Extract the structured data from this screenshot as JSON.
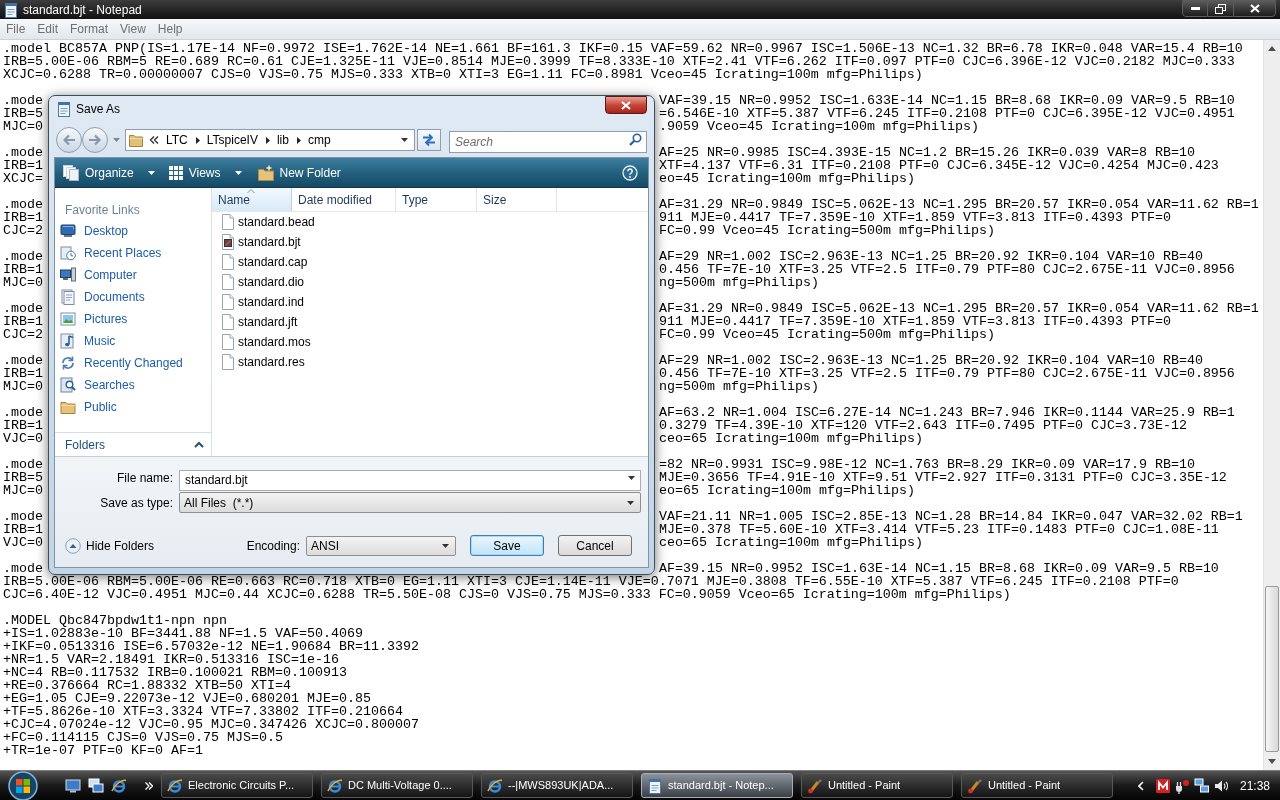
{
  "window": {
    "title": "standard.bjt - Notepad"
  },
  "menu": [
    "File",
    "Edit",
    "Format",
    "View",
    "Help"
  ],
  "editor": {
    "lines": [
      {
        "kind": "text",
        "text": ".model BC857A PNP(IS=1.17E-14 NF=0.9972 ISE=1.762E-14 NE=1.661 BF=161.3 IKF=0.15 VAF=59.62 NR=0.9967 ISC=1.506E-13 NC=1.32 BR=6.78 IKR=0.048 VAR=15.4 RB=10"
      },
      {
        "kind": "text",
        "text": "IRB=5.00E-06 RBM=5 RE=0.689 RC=0.61 CJE=1.325E-11 VJE=0.8514 MJE=0.3999 TF=8.333E-10 XTF=2.41 VTF=6.262 ITF=0.097 PTF=0 CJC=6.396E-12 VJC=0.2182 MJC=0.333"
      },
      {
        "kind": "text",
        "text": "XCJC=0.6288 TR=0.00000007 CJS=0 VJS=0.75 MJS=0.333 XTB=0 XTI=3 EG=1.11 FC=0.8981 Vceo=45 Icrating=100m mfg=Philips)"
      },
      {
        "kind": "blank"
      },
      {
        "kind": "split",
        "left": ".mode",
        "right": "VAF=39.15 NR=0.9952 ISC=1.633E-14 NC=1.15 BR=8.68 IKR=0.09 VAR=9.5 RB=10"
      },
      {
        "kind": "split",
        "left": "IRB=5",
        "right": "=6.546E-10 XTF=5.387 VTF=6.245 ITF=0.2108 PTF=0 CJC=6.395E-12 VJC=0.4951"
      },
      {
        "kind": "split",
        "left": "MJC=0",
        "right": ".9059 Vceo=45 Icrating=100m mfg=Philips)"
      },
      {
        "kind": "blank"
      },
      {
        "kind": "split",
        "left": ".mode",
        "right": "AF=25 NR=0.9985 ISC=4.393E-15 NC=1.2 BR=15.26 IKR=0.039 VAR=8 RB=10"
      },
      {
        "kind": "split",
        "left": "IRB=1",
        "right": "XTF=4.137 VTF=6.31 ITF=0.2108 PTF=0 CJC=6.345E-12 VJC=0.4254 MJC=0.423"
      },
      {
        "kind": "split",
        "left": "XCJC=",
        "right": "eo=45 Icrating=100m mfg=Philips)"
      },
      {
        "kind": "blank"
      },
      {
        "kind": "split",
        "left": ".mode",
        "right": "AF=31.29 NR=0.9849 ISC=5.062E-13 NC=1.295 BR=20.57 IKR=0.054 VAR=11.62 RB=1"
      },
      {
        "kind": "split",
        "left": "IRB=1",
        "right": "911 MJE=0.4417 TF=7.359E-10 XTF=1.859 VTF=3.813 ITF=0.4393 PTF=0"
      },
      {
        "kind": "split",
        "left": "CJC=2",
        "right": "FC=0.99 Vceo=45 Icrating=500m mfg=Philips)"
      },
      {
        "kind": "blank"
      },
      {
        "kind": "split",
        "left": ".mode",
        "right": "AF=29 NR=1.002 ISC=2.963E-13 NC=1.25 BR=20.92 IKR=0.104 VAR=10 RB=40"
      },
      {
        "kind": "split",
        "left": "IRB=1",
        "right": "0.456 TF=7E-10 XTF=3.25 VTF=2.5 ITF=0.79 PTF=80 CJC=2.675E-11 VJC=0.8956"
      },
      {
        "kind": "split",
        "left": "MJC=0",
        "right": "ng=500m mfg=Philips)"
      },
      {
        "kind": "blank"
      },
      {
        "kind": "split",
        "left": ".mode",
        "right": "AF=31.29 NR=0.9849 ISC=5.062E-13 NC=1.295 BR=20.57 IKR=0.054 VAR=11.62 RB=1"
      },
      {
        "kind": "split",
        "left": "IRB=1",
        "right": "911 MJE=0.4417 TF=7.359E-10 XTF=1.859 VTF=3.813 ITF=0.4393 PTF=0"
      },
      {
        "kind": "split",
        "left": "CJC=2",
        "right": "FC=0.99 Vceo=45 Icrating=500m mfg=Philips)"
      },
      {
        "kind": "blank"
      },
      {
        "kind": "split",
        "left": ".mode",
        "right": "AF=29 NR=1.002 ISC=2.963E-13 NC=1.25 BR=20.92 IKR=0.104 VAR=10 RB=40"
      },
      {
        "kind": "split",
        "left": "IRB=1",
        "right": "0.456 TF=7E-10 XTF=3.25 VTF=2.5 ITF=0.79 PTF=80 CJC=2.675E-11 VJC=0.8956"
      },
      {
        "kind": "split",
        "left": "MJC=0",
        "right": "ng=500m mfg=Philips)"
      },
      {
        "kind": "blank"
      },
      {
        "kind": "split",
        "left": ".mode",
        "right": "AF=63.2 NR=1.004 ISC=6.27E-14 NC=1.243 BR=7.946 IKR=0.1144 VAR=25.9 RB=1"
      },
      {
        "kind": "split",
        "left": "IRB=1",
        "right": "0.3279 TF=4.39E-10 XTF=120 VTF=2.643 ITF=0.7495 PTF=0 CJC=3.73E-12"
      },
      {
        "kind": "split",
        "left": "VJC=0",
        "right": "ceo=65 Icrating=100m mfg=Philips)"
      },
      {
        "kind": "blank"
      },
      {
        "kind": "split",
        "left": ".mode",
        "right": "=82 NR=0.9931 ISC=9.98E-12 NC=1.763 BR=8.29 IKR=0.09 VAR=17.9 RB=10"
      },
      {
        "kind": "split",
        "left": "IRB=5",
        "right": "MJE=0.3656 TF=4.91E-10 XTF=9.51 VTF=2.927 ITF=0.3131 PTF=0 CJC=3.35E-12"
      },
      {
        "kind": "split",
        "left": "MJC=0",
        "right": "eo=65 Icrating=100m mfg=Philips)"
      },
      {
        "kind": "blank"
      },
      {
        "kind": "split",
        "left": ".mode",
        "right": "VAF=21.11 NR=1.005 ISC=2.85E-13 NC=1.28 BR=14.84 IKR=0.047 VAR=32.02 RB=1"
      },
      {
        "kind": "split",
        "left": "IRB=1",
        "right": "MJE=0.378 TF=5.60E-10 XTF=3.414 VTF=5.23 ITF=0.1483 PTF=0 CJC=1.08E-11"
      },
      {
        "kind": "split",
        "left": "VJC=0",
        "right": "ceo=65 Icrating=100m mfg=Philips)"
      },
      {
        "kind": "blank"
      },
      {
        "kind": "split",
        "left": ".mode",
        "right": "AF=39.15 NR=0.9952 ISC=1.63E-14 NC=1.15 BR=8.68 IKR=0.09 VAR=9.5 RB=10"
      },
      {
        "kind": "text",
        "text": "IRB=5.00E-06 RBM=5.00E-06 RE=0.663 RC=0.718 XTB=0 EG=1.11 XTI=3 CJE=1.14E-11 VJE=0.7071 MJE=0.3808 TF=6.55E-10 XTF=5.387 VTF=6.245 ITF=0.2108 PTF=0"
      },
      {
        "kind": "text",
        "text": "CJC=6.40E-12 VJC=0.4951 MJC=0.44 XCJC=0.6288 TR=5.50E-08 CJS=0 VJS=0.75 MJS=0.333 FC=0.9059 Vceo=65 Icrating=100m mfg=Philips)"
      },
      {
        "kind": "blank"
      },
      {
        "kind": "text",
        "text": ".MODEL Qbc847bpdw1t1-npn npn"
      },
      {
        "kind": "text",
        "text": "+IS=1.02883e-10 BF=3441.88 NF=1.5 VAF=50.4069"
      },
      {
        "kind": "text",
        "text": "+IKF=0.0513316 ISE=6.57032e-12 NE=1.90684 BR=11.3392"
      },
      {
        "kind": "text",
        "text": "+NR=1.5 VAR=2.18491 IKR=0.513316 ISC=1e-16"
      },
      {
        "kind": "text",
        "text": "+NC=4 RB=0.117532 IRB=0.100021 RBM=0.100913"
      },
      {
        "kind": "text",
        "text": "+RE=0.376664 RC=1.88332 XTB=50 XTI=4"
      },
      {
        "kind": "text",
        "text": "+EG=1.05 CJE=9.22073e-12 VJE=0.680201 MJE=0.85"
      },
      {
        "kind": "text",
        "text": "+TF=5.8626e-10 XTF=3.3324 VTF=7.33802 ITF=0.210664"
      },
      {
        "kind": "text",
        "text": "+CJC=4.07024e-12 VJC=0.95 MJC=0.347426 XCJC=0.800007"
      },
      {
        "kind": "text",
        "text": "+FC=0.114115 CJS=0 VJS=0.75 MJS=0.5"
      },
      {
        "kind": "text",
        "text": "+TR=1e-07 PTF=0 KF=0 AF=1"
      }
    ]
  },
  "dialog": {
    "title": "Save As",
    "breadcrumb": [
      "LTC",
      "LTspiceIV",
      "lib",
      "cmp"
    ],
    "search": {
      "placeholder": "Search"
    },
    "toolbar": [
      {
        "label": "Organize",
        "dropdown": true
      },
      {
        "label": "Views",
        "dropdown": true
      },
      {
        "label": "New Folder",
        "dropdown": false
      }
    ],
    "favorite_links": {
      "title": "Favorite Links",
      "items": [
        "Desktop",
        "Recent Places",
        "Computer",
        "Documents",
        "Pictures",
        "Music",
        "Recently Changed",
        "Searches",
        "Public"
      ]
    },
    "folders": {
      "label": "Folders",
      "expanded": false
    },
    "columns": [
      {
        "label": "Name",
        "sorted": true
      },
      {
        "label": "Date modified",
        "sorted": false
      },
      {
        "label": "Type",
        "sorted": false
      },
      {
        "label": "Size",
        "sorted": false
      }
    ],
    "files": [
      {
        "name": "standard.bead",
        "kind": "plain"
      },
      {
        "name": "standard.bjt",
        "kind": "app"
      },
      {
        "name": "standard.cap",
        "kind": "plain"
      },
      {
        "name": "standard.dio",
        "kind": "plain"
      },
      {
        "name": "standard.ind",
        "kind": "plain"
      },
      {
        "name": "standard.jft",
        "kind": "plain"
      },
      {
        "name": "standard.mos",
        "kind": "plain"
      },
      {
        "name": "standard.res",
        "kind": "plain"
      }
    ],
    "file_name": {
      "label": "File name:",
      "value": "standard.bjt"
    },
    "save_as_type": {
      "label": "Save as type:",
      "value": "All Files  (*.*)"
    },
    "hide_folders": "Hide Folders",
    "encoding": {
      "label": "Encoding:",
      "value": "ANSI"
    },
    "buttons": [
      {
        "label": "Save",
        "default": true
      },
      {
        "label": "Cancel",
        "default": false
      }
    ]
  },
  "taskbar": {
    "tasks": [
      {
        "label": "Electronic Circuits P...",
        "kind": "browser",
        "selected": false
      },
      {
        "label": "DC Multi-Voltage 0....",
        "kind": "browser",
        "selected": false
      },
      {
        "label": "--|MWS893UK|ADA...",
        "kind": "browser",
        "selected": false
      },
      {
        "label": "standard.bjt - Notep...",
        "kind": "editor",
        "selected": true
      },
      {
        "label": "Untitled - Paint",
        "kind": "paint",
        "selected": false
      },
      {
        "label": "Untitled - Paint",
        "kind": "paint",
        "selected": false
      }
    ],
    "clock": "21:38"
  }
}
